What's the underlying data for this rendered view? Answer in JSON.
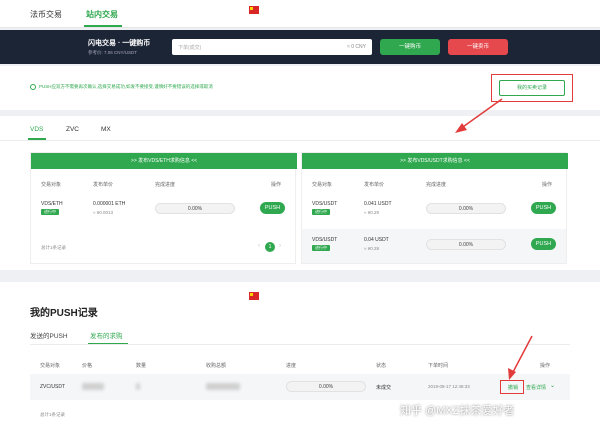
{
  "nav": {
    "tab1": "法币交易",
    "tab2": "站内交易"
  },
  "banner": {
    "title": "闪电交易 · 一键购币",
    "ref_price": "参考价: 7.06 CNY/USDT",
    "amount_placeholder": "下单(成交)",
    "amount_unit": "≈ 0 CNY",
    "buy_btn": "一键购币",
    "sell_btn": "一键卖币"
  },
  "notice": {
    "text": "PUSH应双方不需要再次确认,选择交易成功,如发不要接受,谨慎好不要错误的选择或取消",
    "record_btn": "我的买卖记录"
  },
  "coin_tabs": [
    "VDS",
    "ZVC",
    "MX"
  ],
  "left_panel": {
    "header": ">> 发布VDS/ETH求购信息 <<",
    "cols": [
      "交易对象",
      "发布单价",
      "完成进度",
      "操作"
    ],
    "row": {
      "pair": "VDS/ETH",
      "tag": "进行中",
      "price": "0.000001 ETH",
      "price_sub": "≈ ¥0.0013",
      "progress": "0.00%",
      "action": "PUSH"
    },
    "total": "总计1条记录",
    "page": "1"
  },
  "right_panel": {
    "header": ">> 发布VDS/USDT求购信息 <<",
    "cols": [
      "交易对象",
      "发布单价",
      "完成进度",
      "操作"
    ],
    "rows": [
      {
        "pair": "VDS/USDT",
        "tag": "进行中",
        "price": "0.041 USDT",
        "price_sub": "≈ ¥0.29",
        "progress": "0.00%",
        "action": "PUSH"
      },
      {
        "pair": "VDS/USDT",
        "tag": "进行中",
        "price": "0.04 USDT",
        "price_sub": "≈ ¥0.28",
        "progress": "0.00%",
        "action": "PUSH"
      }
    ]
  },
  "records": {
    "title": "我的PUSH记录",
    "tabs": [
      "发送的PUSH",
      "发布的求购"
    ],
    "cols": [
      "交易对象",
      "价格",
      "数量",
      "收购总额",
      "进度",
      "状态",
      "下单时间",
      "操作"
    ],
    "row": {
      "pair": "ZVC/USDT",
      "progress": "0.00%",
      "status": "未成交",
      "time": "2019-08-17 12:48:33",
      "revoke": "撤销",
      "detail": "查看详情"
    },
    "total": "总计1条记录"
  },
  "watermark": "知乎 @MXZ抹茶爱好者",
  "colors": {
    "accent": "#2fa84f",
    "danger": "#e5484d",
    "arrow": "#e23b3b"
  }
}
